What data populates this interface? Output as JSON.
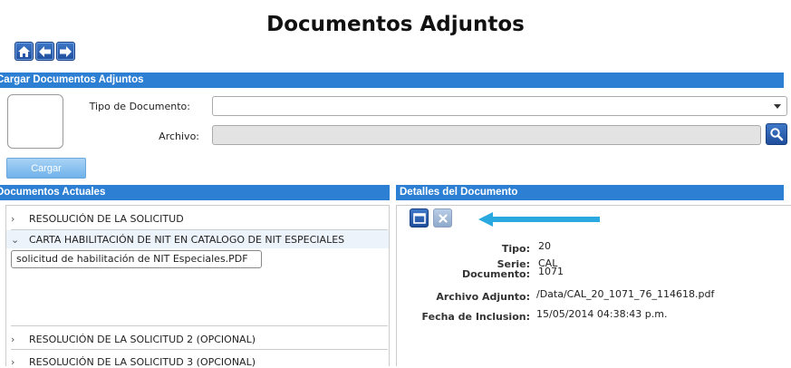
{
  "page": {
    "title": "Documentos Adjuntos"
  },
  "nav": {
    "icons": [
      "home-icon",
      "arrow-left-icon",
      "arrow-right-icon"
    ]
  },
  "upload": {
    "section_title": "Cargar Documentos Adjuntos",
    "tipo_label": "Tipo de Documento:",
    "tipo_value": "",
    "archivo_label": "Archivo:",
    "archivo_value": "",
    "cargar_label": "Cargar"
  },
  "current": {
    "section_title": "Documentos Actuales",
    "items": [
      {
        "label": "RESOLUCIÓN DE LA SOLICITUD",
        "expanded": false
      },
      {
        "label": "CARTA HABILITACIÓN DE NIT EN CATALOGO DE NIT ESPECIALES",
        "expanded": true
      },
      {
        "label": "RESOLUCIÓN DE LA SOLICITUD 2 (OPCIONAL)",
        "expanded": false
      },
      {
        "label": "RESOLUCIÓN DE LA SOLICITUD 3 (OPCIONAL)",
        "expanded": false
      }
    ],
    "file": "solicitud de habilitación de NIT Especiales.PDF"
  },
  "details": {
    "section_title": "Detalles del Documento",
    "tipo_label": "Tipo:",
    "tipo_value": "20",
    "serie_label": "Serie:",
    "serie_value": "CAL",
    "documento_label": "Documento:",
    "documento_value": "1071",
    "archivo_label": "Archivo Adjunto:",
    "archivo_value": "/Data/CAL_20_1071_76_114618.pdf",
    "fecha_label": "Fecha de Inclusion:",
    "fecha_value": "15/05/2014 04:38:43 p.m."
  },
  "colors": {
    "section_bar": "#2d7fd4",
    "nav_button": "#1f4e9c",
    "annotation_arrow": "#2aa8e0"
  }
}
